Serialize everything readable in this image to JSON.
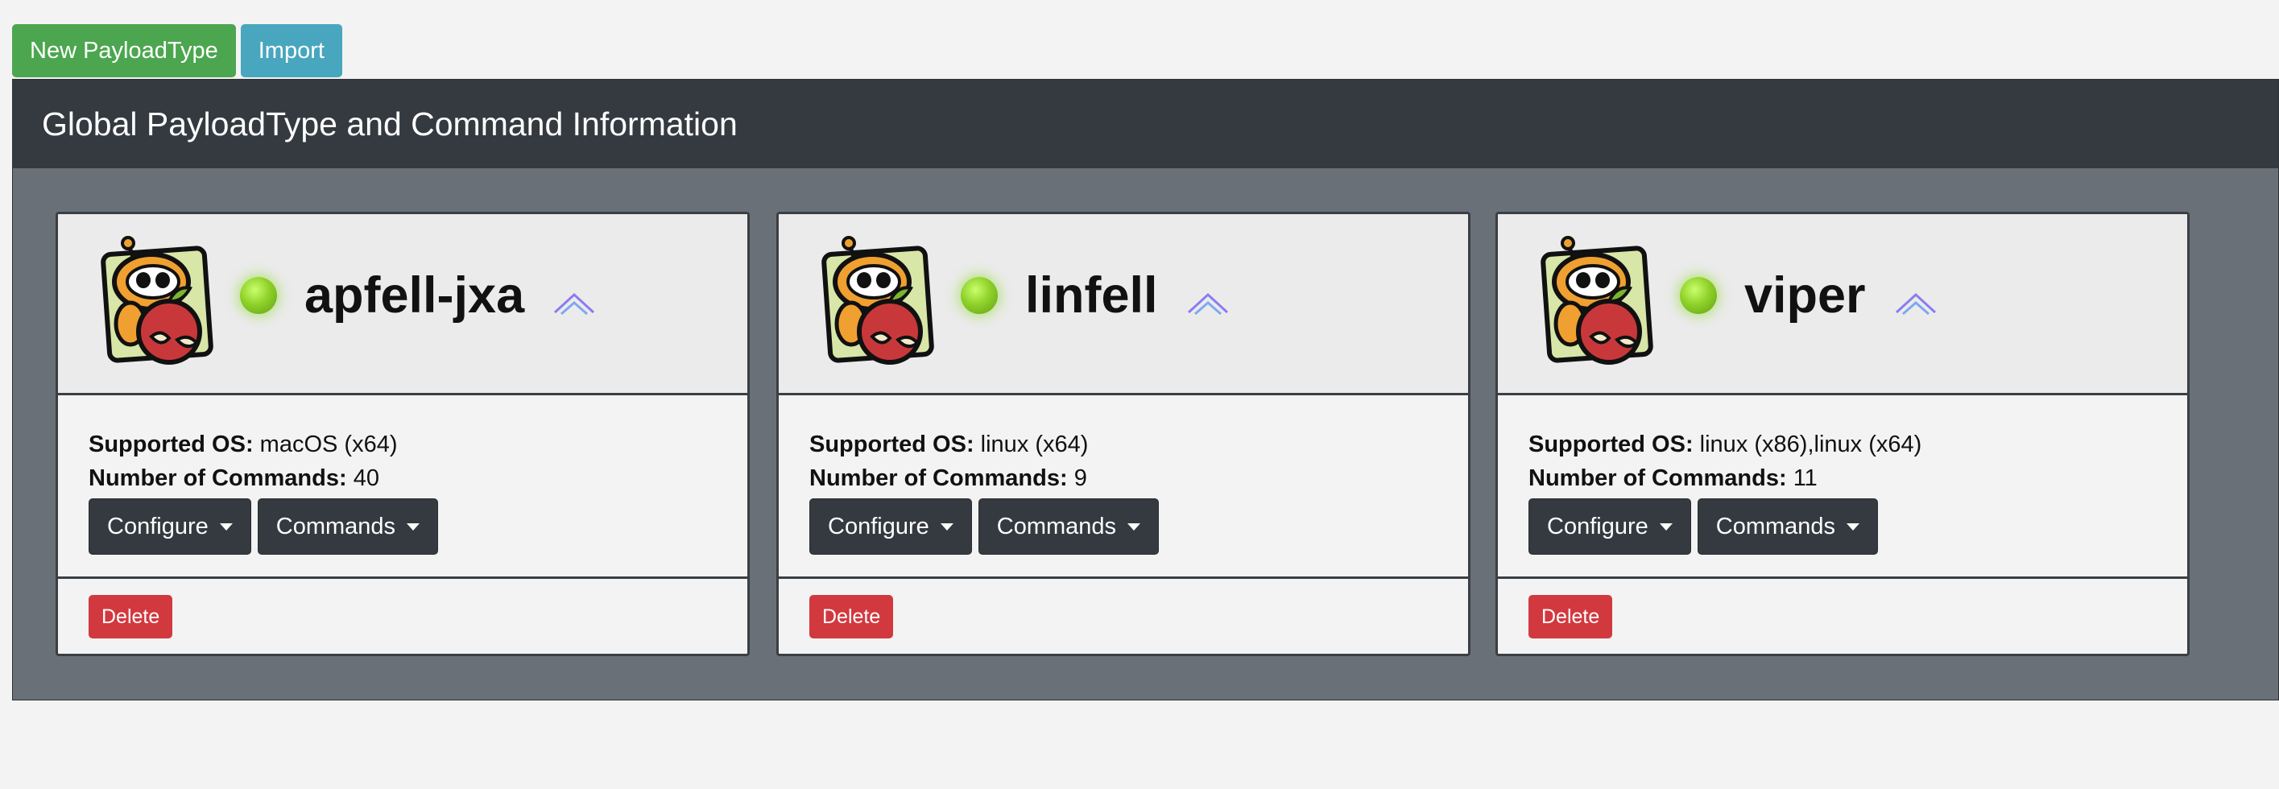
{
  "toolbar": {
    "new_label": "New PayloadType",
    "import_label": "Import"
  },
  "panel": {
    "title": "Global PayloadType and Command Information"
  },
  "labels": {
    "supported_os": "Supported OS:",
    "num_commands": "Number of Commands:",
    "configure": "Configure",
    "commands": "Commands",
    "delete": "Delete"
  },
  "cards": [
    {
      "name": "apfell-jxa",
      "os": "macOS (x64)",
      "commands": "40",
      "status": "online"
    },
    {
      "name": "linfell",
      "os": "linux (x64)",
      "commands": "9",
      "status": "online"
    },
    {
      "name": "viper",
      "os": "linux (x86),linux (x64)",
      "commands": "11",
      "status": "online"
    }
  ],
  "colors": {
    "success": "#4ca64f",
    "info": "#48a6be",
    "dark": "#343a40",
    "danger": "#d1393f",
    "panel_bg": "#6a7078",
    "status_online": "#8fd12a"
  },
  "icons": {
    "logo": "robot-apple-logo-icon",
    "status": "status-online-icon",
    "chevron": "chevron-up-icon",
    "caret": "caret-down-icon"
  }
}
